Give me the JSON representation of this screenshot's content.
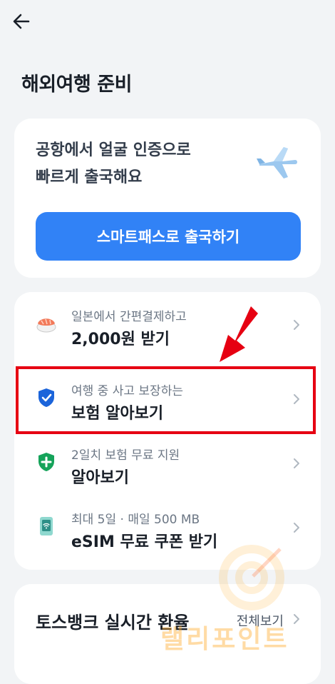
{
  "header": {
    "title": "해외여행 준비"
  },
  "promo": {
    "line1": "공항에서 얼굴 인증으로",
    "line2": "빠르게 출국해요",
    "button": "스마트패스로 출국하기"
  },
  "offers": [
    {
      "sub": "일본에서 간편결제하고",
      "main": "2,000원 받기",
      "icon": "sushi-icon"
    },
    {
      "sub": "여행 중 사고 보장하는",
      "main": "보험 알아보기",
      "icon": "shield-check-icon"
    },
    {
      "sub": "2일치 보험 무료 지원",
      "main": "알아보기",
      "icon": "shield-plus-icon"
    },
    {
      "sub": "최대 5일 · 매일 500 MB",
      "main": "eSIM 무료 쿠폰 받기",
      "icon": "esim-wifi-icon"
    }
  ],
  "exchange": {
    "title": "토스뱅크 실시간 환율",
    "view_all": "전체보기"
  },
  "watermark": "랠리포인트",
  "colors": {
    "primary": "#3182f6",
    "highlight": "#e60012",
    "background": "#f2f4f6"
  }
}
